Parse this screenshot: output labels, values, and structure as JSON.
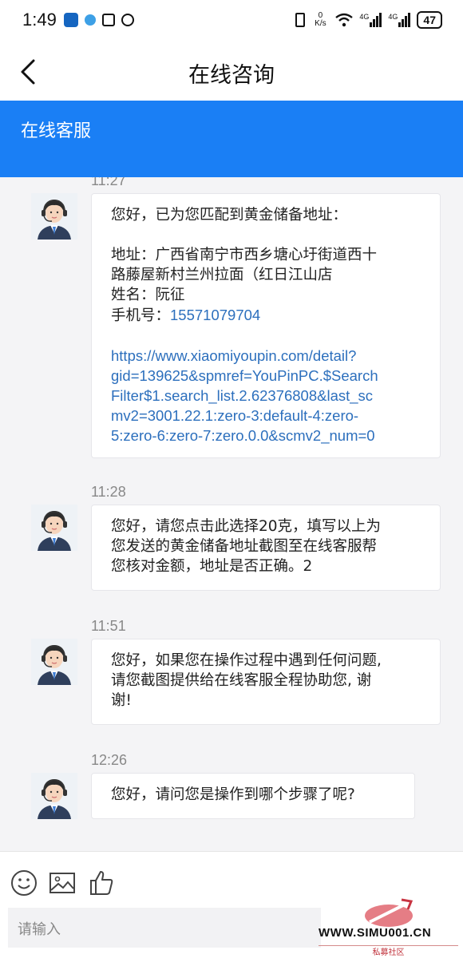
{
  "status_bar": {
    "time": "1:49",
    "net_speed": "0 K/s",
    "net1": "4G",
    "net2": "4G",
    "battery": "47"
  },
  "nav": {
    "title": "在线咨询",
    "back_icon": "back-chevron-icon"
  },
  "header": {
    "title": "在线客服",
    "color": "#1a7ff5"
  },
  "messages": [
    {
      "time": "11:27",
      "lines": [
        "您好，已为您匹配到黄金储备地址：",
        "",
        "地址：广西省南宁市西乡塘心圩街道西十",
        "路藤屋新村兰州拉面（红日江山店",
        "姓名：阮征"
      ],
      "phone_label": "手机号：",
      "phone": "15571079704",
      "link_lines": [
        "https://www.xiaomiyoupin.com/detail?",
        "gid=139625&spmref=YouPinPC.$Search",
        "Filter$1.search_list.2.62376808&last_sc",
        "mv2=3001.22.1:zero-3:default-4:zero-",
        "5:zero-6:zero-7:zero.0.0&scmv2_num=0"
      ]
    },
    {
      "time": "11:28",
      "lines": [
        "您好，请您点击此选择20克，填写以上为",
        "您发送的黄金储备地址截图至在线客服帮",
        "您核对金额，地址是否正确。2"
      ]
    },
    {
      "time": "11:51",
      "lines": [
        "您好，如果您在操作过程中遇到任何问题,",
        "请您截图提供给在线客服全程协助您, 谢",
        "谢!"
      ]
    },
    {
      "time": "12:26",
      "lines": [
        "您好，请问您是操作到哪个步骤了呢?"
      ]
    }
  ],
  "toolbar": {
    "emoji_icon": "emoji-icon",
    "image_icon": "image-icon",
    "like_icon": "thumbs-up-icon",
    "input_placeholder": "请输入"
  },
  "watermark": {
    "text": "WWW.SIMU001.CN",
    "sub": "私募社区"
  }
}
